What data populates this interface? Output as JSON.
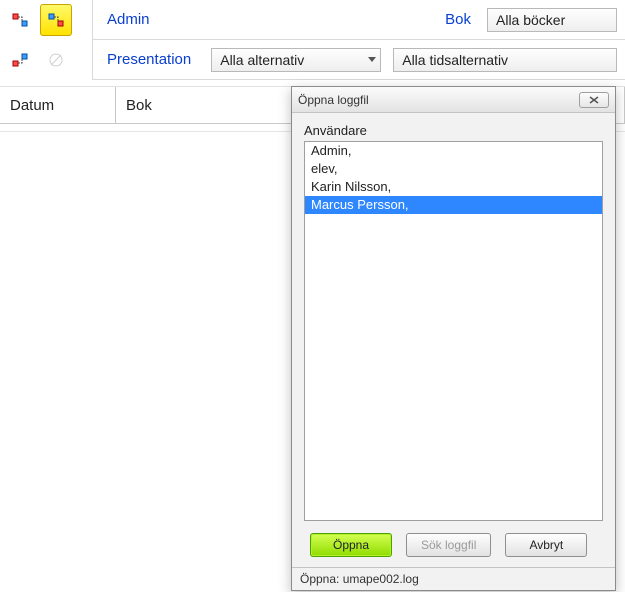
{
  "header": {
    "user_label": "Admin",
    "presentation_label": "Presentation",
    "bok_label": "Bok",
    "combo_presentation": "Alla alternativ",
    "combo_time": "Alla tidsalternativ",
    "combo_books": "Alla böcker"
  },
  "table": {
    "col1": "Datum",
    "col2": "Bok"
  },
  "dialog": {
    "title": "Öppna loggfil",
    "list_label": "Användare",
    "users": [
      "Admin,",
      "elev,",
      "Karin Nilsson,",
      "Marcus Persson,"
    ],
    "selected_index": 3,
    "open": "Öppna",
    "search": "Sök loggfil",
    "cancel": "Avbryt",
    "status": "Öppna: umape002.log"
  }
}
